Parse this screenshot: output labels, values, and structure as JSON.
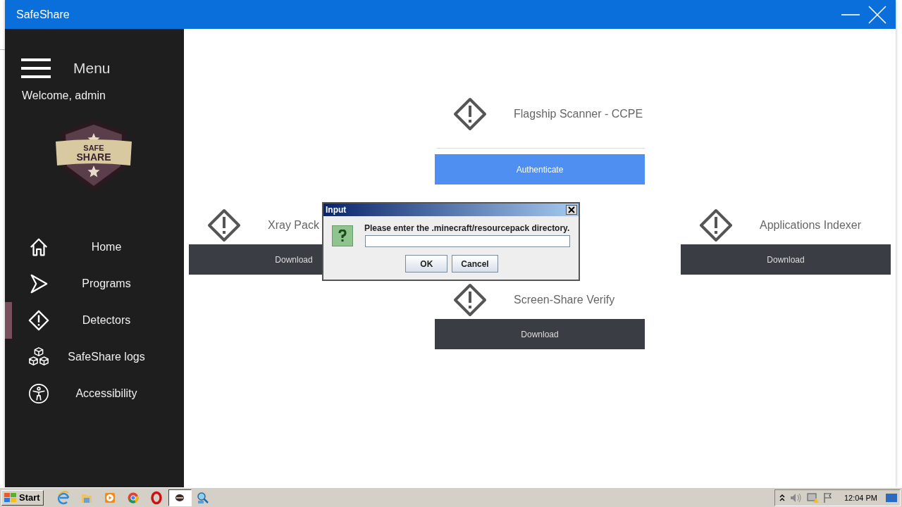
{
  "window": {
    "title": "SafeShare"
  },
  "sidebar": {
    "menu_label": "Menu",
    "welcome": "Welcome, admin",
    "logo": {
      "top": "SAFE",
      "bottom": "SHARE"
    },
    "items": [
      {
        "label": "Home",
        "selected": false
      },
      {
        "label": "Programs",
        "selected": false
      },
      {
        "label": "Detectors",
        "selected": true
      },
      {
        "label": "SafeShare logs",
        "selected": false
      },
      {
        "label": "Accessibility",
        "selected": false
      }
    ]
  },
  "detectors": [
    {
      "title": "Flagship Scanner - CCPE",
      "button": {
        "label": "Authenticate",
        "kind": "primary"
      }
    },
    {
      "title": "Xray Pack",
      "button": {
        "label": "Download",
        "kind": "dark"
      }
    },
    {
      "title": "Applications Indexer",
      "button": {
        "label": "Download",
        "kind": "dark"
      }
    },
    {
      "title": "Screen-Share Verify",
      "button": {
        "label": "Download",
        "kind": "dark"
      }
    }
  ],
  "dialog": {
    "title": "Input",
    "message": "Please enter the .minecraft/resourcepack directory.",
    "buttons": [
      "OK",
      "Cancel"
    ]
  },
  "taskbar": {
    "start": "Start",
    "apps": [
      {
        "selected": false
      },
      {
        "selected": false
      },
      {
        "selected": false
      },
      {
        "selected": false
      },
      {
        "selected": false
      },
      {
        "selected": true
      },
      {
        "selected": false
      }
    ],
    "clock": "12:04 PM"
  }
}
